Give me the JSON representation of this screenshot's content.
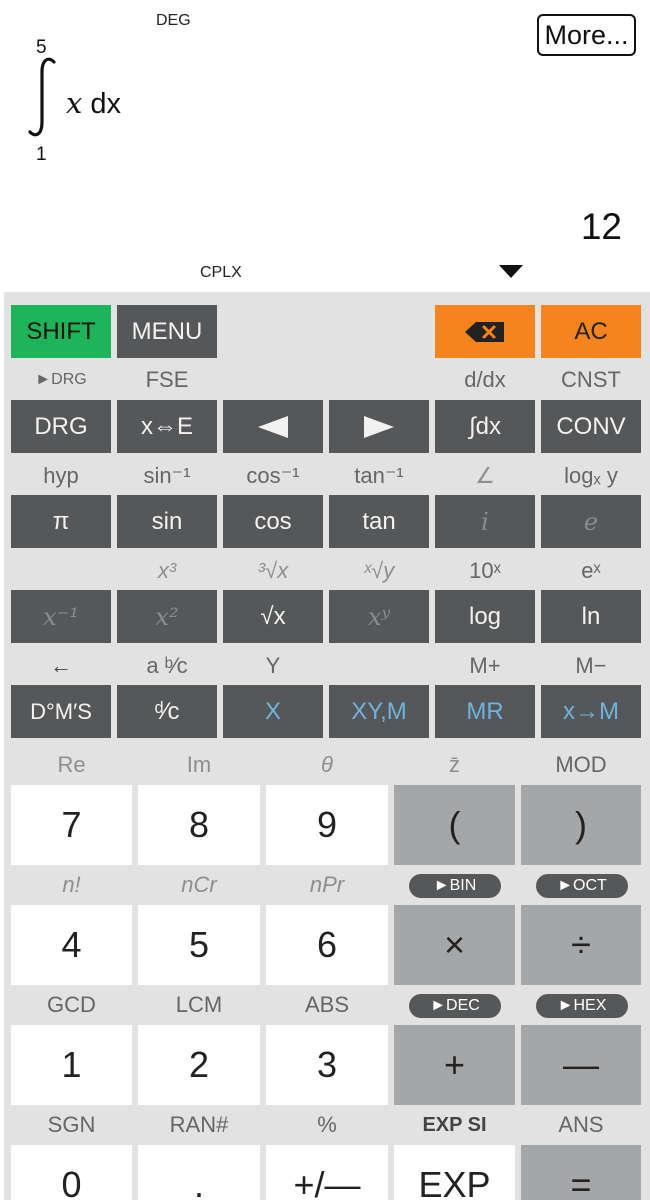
{
  "display": {
    "angle_mode": "DEG",
    "complex_mode": "CPLX",
    "more_label": "More...",
    "integral": {
      "upper": "5",
      "lower": "1",
      "variable": "x",
      "dx": "dx"
    },
    "result": "12"
  },
  "row0": {
    "shift": "SHIFT",
    "menu": "MENU",
    "backspace": "✖",
    "ac": "AC"
  },
  "row1_labels": [
    "►DRG",
    "FSE",
    "",
    "",
    "d/dx",
    "CNST"
  ],
  "row1_keys": [
    "DRG",
    "x⇔E",
    "◀",
    "▶",
    "∫dx",
    "CONV"
  ],
  "row2_labels": [
    "hyp",
    "sin⁻¹",
    "cos⁻¹",
    "tan⁻¹",
    "∠",
    "logₓ y"
  ],
  "row2_keys": [
    "π",
    "sin",
    "cos",
    "tan",
    "i",
    "e"
  ],
  "row3_labels": [
    "",
    "x³",
    "³√x",
    "ˣ√y",
    "10ˣ",
    "eˣ"
  ],
  "row3_keys": [
    "x⁻¹",
    "x²",
    "√x",
    "xʸ",
    "log",
    "ln"
  ],
  "row4_labels": [
    "←",
    "a ᵇ⁄c",
    "Y",
    "",
    "M+",
    "M−"
  ],
  "row4_keys": [
    "D°M′S",
    "ᵈ⁄c",
    "X",
    "XY,M",
    "MR",
    "x→M"
  ],
  "row5_labels": [
    "Re",
    "Im",
    "θ",
    "z̄",
    "MOD"
  ],
  "row5_keys": [
    "7",
    "8",
    "9",
    "(",
    ")"
  ],
  "row6_labels": [
    "n!",
    "nCr",
    "nPr"
  ],
  "row6_pills": [
    "►BIN",
    "►OCT"
  ],
  "row6_keys": [
    "4",
    "5",
    "6",
    "×",
    "÷"
  ],
  "row7_labels": [
    "GCD",
    "LCM",
    "ABS"
  ],
  "row7_pills": [
    "►DEC",
    "►HEX"
  ],
  "row7_keys": [
    "1",
    "2",
    "3",
    "+",
    "—"
  ],
  "row8_labels": [
    "SGN",
    "RAN#",
    "%",
    "EXP SI",
    "ANS"
  ],
  "row8_keys": [
    "0",
    ".",
    "+/—",
    "EXP",
    "="
  ]
}
